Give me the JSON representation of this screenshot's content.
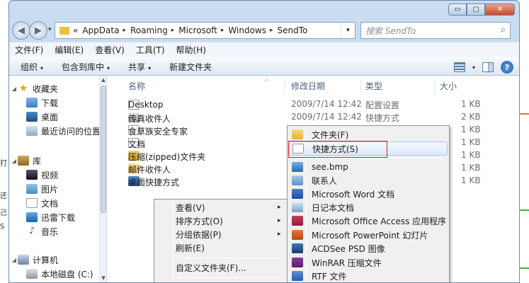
{
  "window": {
    "caption_buttons": {
      "minimize": "▭",
      "maximize": "▢",
      "close": "✕"
    }
  },
  "nav": {
    "back": "◀",
    "forward": "▶",
    "dropdown": "▾",
    "address": {
      "prefix": "«",
      "crumbs": [
        "AppData",
        "Roaming",
        "Microsoft",
        "Windows",
        "SendTo"
      ],
      "sep": "▸"
    },
    "refresh": "↻",
    "search_placeholder": "搜索 SendTo",
    "search_icon": "⌕"
  },
  "menubar": [
    "文件(F)",
    "编辑(E)",
    "查看(V)",
    "工具(T)",
    "帮助(H)"
  ],
  "commandbar": [
    {
      "label": "组织",
      "arrow": "▾"
    },
    {
      "label": "包含到库中",
      "arrow": "▾"
    },
    {
      "label": "共享",
      "arrow": "▾"
    },
    {
      "label": "新建文件夹",
      "arrow": ""
    }
  ],
  "sidebar": {
    "favorites": {
      "label": "收藏夹",
      "items": [
        "下载",
        "桌面",
        "最近访问的位置"
      ]
    },
    "libraries": {
      "label": "库",
      "items": [
        "视频",
        "图片",
        "文档",
        "迅雷下载",
        "音乐"
      ]
    },
    "computer": {
      "label": "计算机",
      "items": [
        "本地磁盘 (C:)"
      ]
    },
    "twisty_open": "◢",
    "scroll_up": "▲",
    "scroll_down": "▼"
  },
  "columns": {
    "name": "名称",
    "date": "修改日期",
    "type": "类型",
    "size": "大小",
    "sort_caret": "︿"
  },
  "files": [
    {
      "name": "Desktop",
      "date": "2009/7/14 12:42",
      "type": "配置设置",
      "size": "1 KB",
      "icon": "shortcut-icon"
    },
    {
      "name": "传真收件人",
      "date": "2009/7/14 12:42",
      "type": "快捷方式",
      "size": "2 KB",
      "icon": "fax-icon"
    },
    {
      "name": "食草族安全专家",
      "date": "",
      "type": "",
      "size": "1 KB",
      "icon": "shortcut-icon"
    },
    {
      "name": "文档",
      "date": "",
      "type": "",
      "size": "1 KB",
      "icon": "document-icon"
    },
    {
      "name": "压缩(zipped)文件夹",
      "date": "",
      "type": "",
      "size": "1 KB",
      "icon": "zip-folder-icon"
    },
    {
      "name": "邮件收件人",
      "date": "",
      "type": "",
      "size": "1 KB",
      "icon": "mail-icon"
    },
    {
      "name": "桌面快捷方式",
      "date": "",
      "type": "",
      "size": "1 KB",
      "icon": "desktop-icon"
    }
  ],
  "context_menu": {
    "items": [
      "查看(V)",
      "排序方式(O)",
      "分组依据(P)",
      "刷新(E)",
      "自定义文件夹(F)..."
    ],
    "submenu_arrow": "▸"
  },
  "new_submenu": {
    "items": [
      {
        "label": "文件夹(F)",
        "icon": "folder-icon"
      },
      {
        "label": "快捷方式(S)",
        "icon": "shortcut-icon"
      },
      {
        "label": "see.bmp",
        "icon": "bitmap-icon"
      },
      {
        "label": "联系人",
        "icon": "contact-icon"
      },
      {
        "label": "Microsoft Word 文档",
        "icon": "word-icon"
      },
      {
        "label": "日记本文档",
        "icon": "journal-icon"
      },
      {
        "label": "Microsoft Office Access 应用程序",
        "icon": "access-icon"
      },
      {
        "label": "Microsoft PowerPoint 幻灯片",
        "icon": "powerpoint-icon"
      },
      {
        "label": "ACDSee PSD 图像",
        "icon": "psd-icon"
      },
      {
        "label": "WinRAR 压缩文件",
        "icon": "winrar-icon"
      },
      {
        "label": "RTF 文件",
        "icon": "rtf-icon"
      }
    ]
  },
  "colors": {
    "highlight_box": "#d8202a",
    "window_frame": "#c9dcf0"
  }
}
